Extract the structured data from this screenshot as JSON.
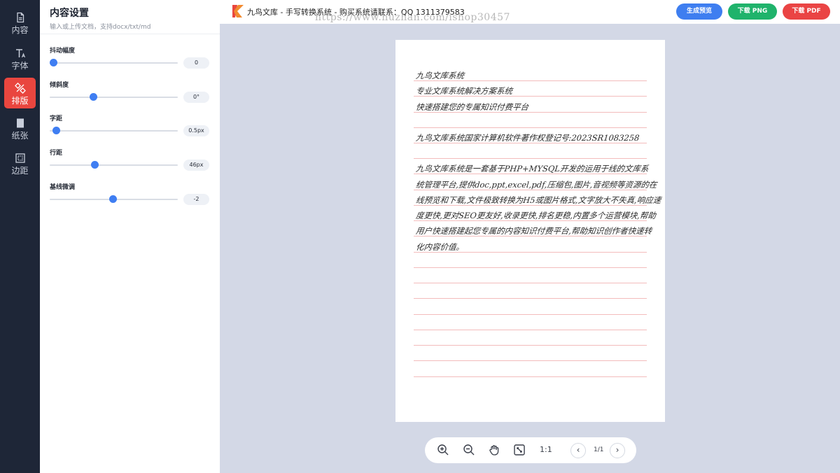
{
  "rail": {
    "items": [
      {
        "label": "内容",
        "icon": "document-icon",
        "active": false
      },
      {
        "label": "字体",
        "icon": "font-icon",
        "active": false
      },
      {
        "label": "排版",
        "icon": "layout-icon",
        "active": true
      },
      {
        "label": "纸张",
        "icon": "paper-icon",
        "active": false
      },
      {
        "label": "边距",
        "icon": "margin-icon",
        "active": false
      }
    ]
  },
  "panel": {
    "title": "内容设置",
    "subtitle": "输入或上传文档，支持docx/txt/md",
    "controls": [
      {
        "label": "抖动幅度",
        "value_text": "0",
        "level": 0.03
      },
      {
        "label": "倾斜度",
        "value_text": "0°",
        "level": 0.34
      },
      {
        "label": "字距",
        "value_text": "0.5px",
        "level": 0.05
      },
      {
        "label": "行距",
        "value_text": "46px",
        "level": 0.35
      },
      {
        "label": "基线微调",
        "value_text": "-2",
        "level": 0.49
      }
    ]
  },
  "topbar": {
    "title": "九鸟文库 - 手写转换系统 - 购买系统请联系：QQ 1311379583",
    "watermark": "https://www.huzhan.com/ishop30457",
    "preview_label": "生成预览",
    "png_label": "下载 PNG",
    "pdf_label": "下载 PDF"
  },
  "paper": {
    "lines": [
      "九鸟文库系统",
      "专业文库系统解决方案系统",
      "快速搭建您的专属知识付费平台",
      "",
      "九鸟文库系统国家计算机软件著作权登记号:2023SR1083258",
      "",
      "九鸟文库系统是一套基于PHP+MYSQL开发的运用于线的文库系",
      "统管理平台,提供doc,ppt,excel,pdf,压缩包,图片,音视频等资源的在",
      "线预览和下载,文件极致转换为H5或图片格式,文字放大不失真,响应速",
      "度更快,更对SEO更友好,收录更快,排名更稳,内置多个运营模块,帮助",
      "用户快速搭建起您专属的内容知识付费平台,帮助知识创作者快速转",
      "化内容价值。"
    ]
  },
  "toolbar": {
    "ratio_label": "1:1",
    "page_label": "1/1"
  },
  "colors": {
    "accent": "#3e7ef0",
    "active_tab": "#e9463f",
    "png_button": "#1fb36b",
    "pdf_button": "#ea4444",
    "rail_background": "#1e2637"
  }
}
